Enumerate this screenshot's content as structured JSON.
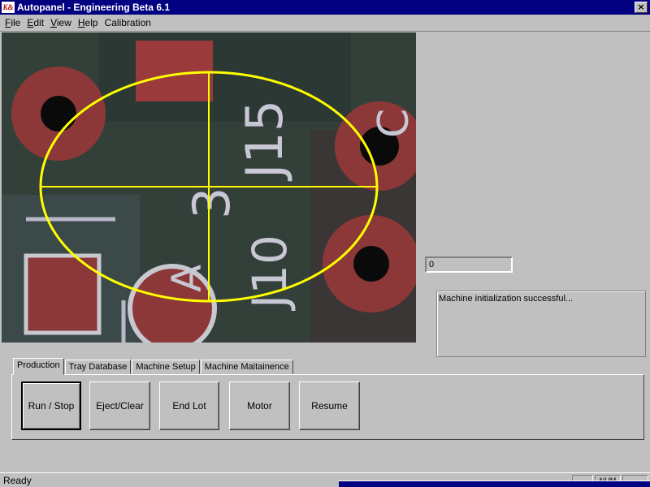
{
  "window": {
    "title": "Autopanel - Engineering Beta 6.1",
    "logo_text": "K&",
    "close_glyph": "×"
  },
  "menu": [
    {
      "label": "File",
      "mnemonic": "F",
      "rest": "ile"
    },
    {
      "label": "Edit",
      "mnemonic": "E",
      "rest": "dit"
    },
    {
      "label": "View",
      "mnemonic": "V",
      "rest": "iew"
    },
    {
      "label": "Help",
      "mnemonic": "H",
      "rest": "elp"
    },
    {
      "label": "Calibration",
      "mnemonic": "",
      "rest": "Calibration"
    }
  ],
  "camera": {
    "board_silkscreen": [
      "J15",
      "3",
      "A",
      "J10",
      "C"
    ],
    "overlay_color": "#ffff00",
    "board_color": "#2f3a2e",
    "pad_color": "#9a3a3a"
  },
  "readout": {
    "value": "0"
  },
  "log": {
    "message": "Machine initialization successful..."
  },
  "tabs": [
    {
      "label": "Production",
      "active": true
    },
    {
      "label": "Tray Database",
      "active": false
    },
    {
      "label": "Machine Setup",
      "active": false
    },
    {
      "label": "Machine Maitainence",
      "active": false
    }
  ],
  "buttons": [
    {
      "label": "Run / Stop",
      "default": true
    },
    {
      "label": "Eject/Clear",
      "default": false
    },
    {
      "label": "End Lot",
      "default": false
    },
    {
      "label": "Motor",
      "default": false
    },
    {
      "label": "Resume",
      "default": false
    }
  ],
  "status": {
    "text": "Ready",
    "panes": [
      "",
      "NUM",
      ""
    ]
  }
}
